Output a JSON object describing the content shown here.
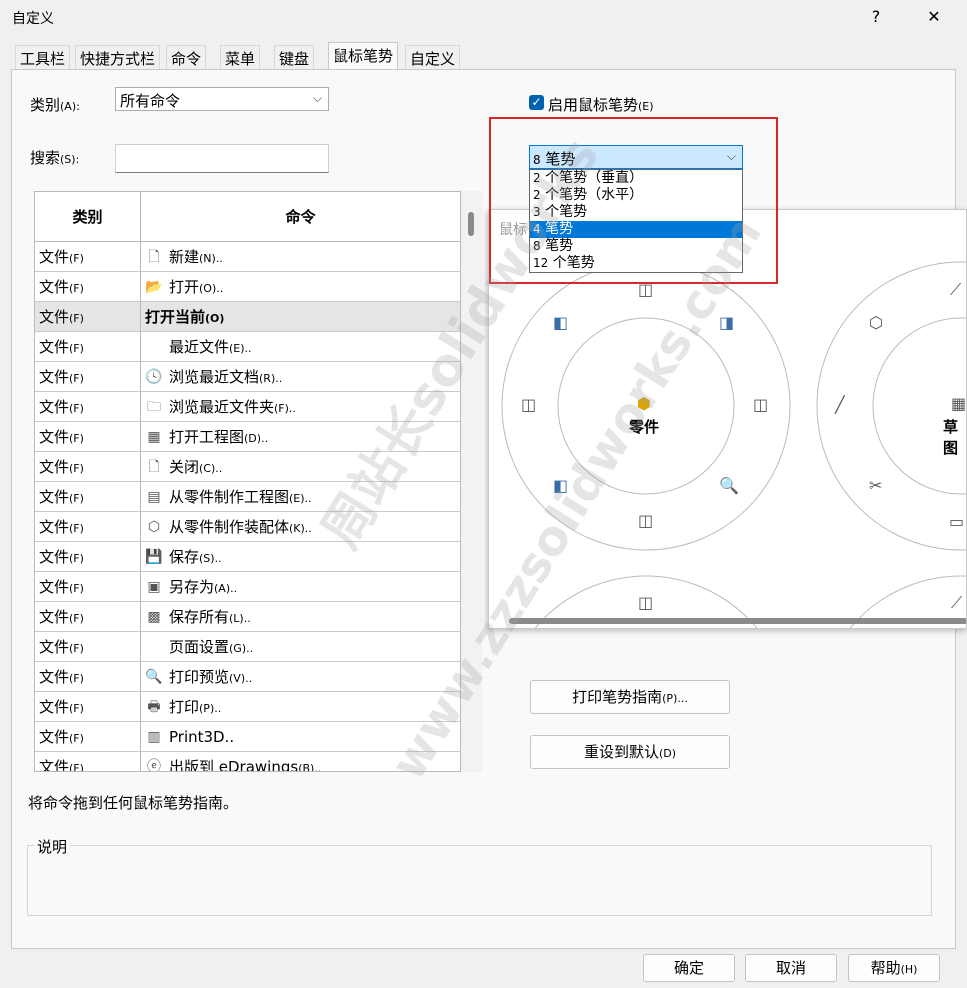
{
  "window": {
    "title": "自定义",
    "help_glyph": "?",
    "close_glyph": "✕"
  },
  "tabs": [
    {
      "label": "工具栏"
    },
    {
      "label": "快捷方式栏"
    },
    {
      "label": "命令"
    },
    {
      "label": "菜单"
    },
    {
      "label": "键盘"
    },
    {
      "label": "鼠标笔势"
    },
    {
      "label": "自定义"
    }
  ],
  "category": {
    "label": "类别",
    "key": "(A):",
    "value": "所有命令"
  },
  "search": {
    "label": "搜索",
    "key": "(S):",
    "value": ""
  },
  "table": {
    "headers": [
      "类别",
      "命令"
    ],
    "rows": [
      {
        "cat": "文件",
        "key": "(F)",
        "cmd": "新建",
        "ckey": "(N)..",
        "icon": "new-document-icon",
        "glyph": "🗋"
      },
      {
        "cat": "文件",
        "key": "(F)",
        "cmd": "打开",
        "ckey": "(O)..",
        "icon": "open-icon",
        "glyph": "📂"
      },
      {
        "cat": "文件",
        "key": "(F)",
        "cmd": "打开当前",
        "ckey": "(O)",
        "icon": "",
        "glyph": ""
      },
      {
        "cat": "文件",
        "key": "(F)",
        "cmd": "最近文件",
        "ckey": "(E)..",
        "icon": "",
        "glyph": ""
      },
      {
        "cat": "文件",
        "key": "(F)",
        "cmd": "浏览最近文档",
        "ckey": "(R)..",
        "icon": "recent-documents-icon",
        "glyph": "🕓"
      },
      {
        "cat": "文件",
        "key": "(F)",
        "cmd": "浏览最近文件夹",
        "ckey": "(F)..",
        "icon": "recent-folders-icon",
        "glyph": "🗀"
      },
      {
        "cat": "文件",
        "key": "(F)",
        "cmd": "打开工程图",
        "ckey": "(D)..",
        "icon": "open-drawing-icon",
        "glyph": "▦"
      },
      {
        "cat": "文件",
        "key": "(F)",
        "cmd": "关闭",
        "ckey": "(C)..",
        "icon": "close-document-icon",
        "glyph": "🗋"
      },
      {
        "cat": "文件",
        "key": "(F)",
        "cmd": "从零件制作工程图",
        "ckey": "(E)..",
        "icon": "make-drawing-icon",
        "glyph": "▤"
      },
      {
        "cat": "文件",
        "key": "(F)",
        "cmd": "从零件制作装配体",
        "ckey": "(K)..",
        "icon": "make-assembly-icon",
        "glyph": "⬡"
      },
      {
        "cat": "文件",
        "key": "(F)",
        "cmd": "保存",
        "ckey": "(S)..",
        "icon": "save-icon",
        "glyph": "💾"
      },
      {
        "cat": "文件",
        "key": "(F)",
        "cmd": "另存为",
        "ckey": "(A)..",
        "icon": "save-as-icon",
        "glyph": "▣"
      },
      {
        "cat": "文件",
        "key": "(F)",
        "cmd": "保存所有",
        "ckey": "(L)..",
        "icon": "save-all-icon",
        "glyph": "▩"
      },
      {
        "cat": "文件",
        "key": "(F)",
        "cmd": "页面设置",
        "ckey": "(G)..",
        "icon": "",
        "glyph": ""
      },
      {
        "cat": "文件",
        "key": "(F)",
        "cmd": "打印预览",
        "ckey": "(V)..",
        "icon": "print-preview-icon",
        "glyph": "🔍"
      },
      {
        "cat": "文件",
        "key": "(F)",
        "cmd": "打印",
        "ckey": "(P)..",
        "icon": "print-icon",
        "glyph": "🖶"
      },
      {
        "cat": "文件",
        "key": "(F)",
        "cmd": "Print3D..",
        "ckey": "",
        "icon": "print3d-icon",
        "glyph": "▥"
      },
      {
        "cat": "文件",
        "key": "(F)",
        "cmd": "出版到 eDrawings",
        "ckey": "(B)..",
        "icon": "edrawings-icon",
        "glyph": "ⓔ"
      }
    ]
  },
  "gesture": {
    "enable_label": "启用鼠标笔势",
    "enable_key": "(E)",
    "enabled": true,
    "checkmark": "✓",
    "selected": {
      "num": "8",
      "label": "笔势"
    },
    "options": [
      {
        "num": "2",
        "label": "个笔势（垂直）"
      },
      {
        "num": "2",
        "label": "个笔势（水平）"
      },
      {
        "num": "3",
        "label": "个笔势"
      },
      {
        "num": "4",
        "label": "笔势"
      },
      {
        "num": "8",
        "label": "笔势"
      },
      {
        "num": "12",
        "label": "个笔势"
      }
    ],
    "highlighted_index": 3
  },
  "preview": {
    "title": "鼠标",
    "part_label": "零件",
    "sketch_label": "草图"
  },
  "buttons": {
    "print_guide": "打印笔势指南",
    "print_guide_key": "(P)...",
    "reset": "重设到默认",
    "reset_key": "(D)",
    "ok": "确定",
    "cancel": "取消",
    "help": "帮助",
    "help_key": "(H)"
  },
  "status_text": "将命令拖到任何鼠标笔势指南。",
  "description_label": "说明",
  "watermark": [
    "周站长solidworks",
    "www.zzzsolidworks.com"
  ]
}
